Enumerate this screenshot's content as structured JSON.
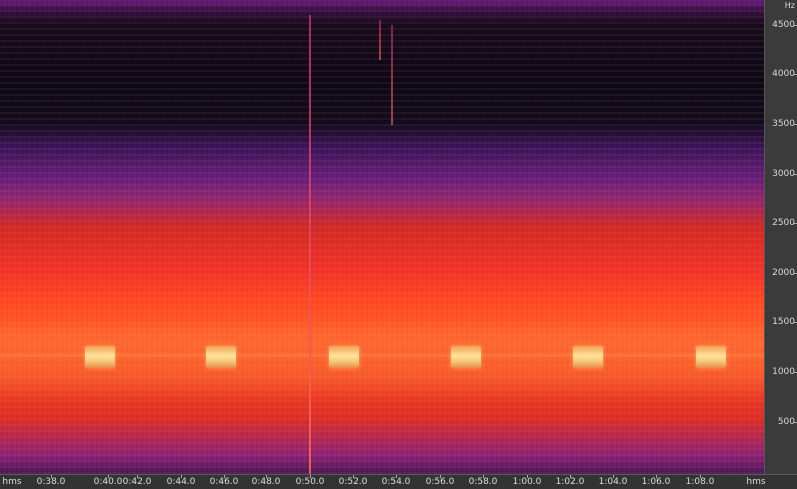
{
  "frequency_axis": {
    "unit": "Hz",
    "labels": [
      {
        "text": "4500",
        "value": 4500
      },
      {
        "text": "4000",
        "value": 4000
      },
      {
        "text": "3500",
        "value": 3500
      },
      {
        "text": "3000",
        "value": 3000
      },
      {
        "text": "2500",
        "value": 2500
      },
      {
        "text": "2000",
        "value": 2000
      },
      {
        "text": "1500",
        "value": 1500
      },
      {
        "text": "1000",
        "value": 1000
      },
      {
        "text": "500",
        "value": 500
      }
    ]
  },
  "time_axis": {
    "left_unit": "hms",
    "right_unit": "hms",
    "labels": [
      "0:38.0",
      "0:40.0",
      "0:42.0",
      "0:44.0",
      "0:46.0",
      "0:48.0",
      "0:50.0",
      "0:52.0",
      "0:54.0",
      "0:56.0",
      "0:58.0",
      "1:00.0",
      "1:02.0",
      "1:04.0",
      "1:06.0",
      "1:08.0"
    ]
  },
  "colors": {
    "low": "#0c0716",
    "mid": "#6a1f7e",
    "high": "#f1332a",
    "peak": "#ffe39a"
  }
}
